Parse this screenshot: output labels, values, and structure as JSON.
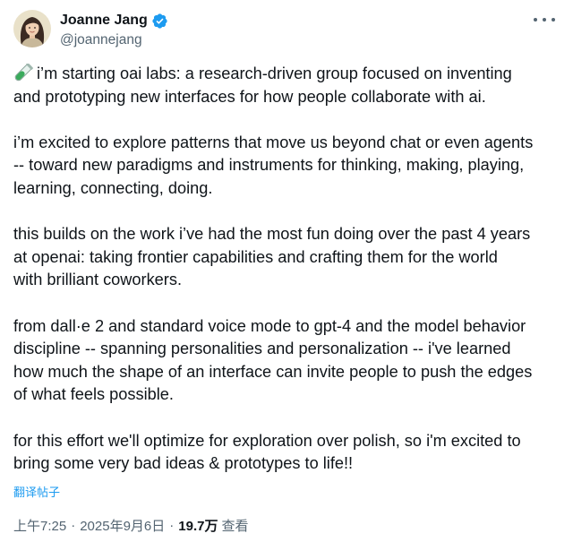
{
  "author": {
    "display_name": "Joanne Jang",
    "handle": "@joannejang",
    "verified": true,
    "avatar_icon": "avatar-illustration"
  },
  "tweet": {
    "lead_icon": "test-tube-icon",
    "paragraphs": [
      [
        "i’m starting oai labs: a research-driven group focused on inventing",
        "and prototyping new interfaces for how people collaborate with ai."
      ],
      [
        "i’m excited to explore patterns that move us beyond chat or even agents",
        "-- toward new paradigms and instruments for thinking, making, playing,",
        "learning, connecting, doing."
      ],
      [
        "this builds on the work i’ve had the most fun doing over the past 4 years",
        "at openai: taking frontier capabilities and crafting them for the world",
        "with brilliant coworkers."
      ],
      [
        "from dall·e 2 and standard voice mode to gpt-4 and the model behavior",
        "discipline -- spanning personalities and personalization -- i've learned",
        "how much the shape of an interface can invite people to push the edges",
        "of what feels possible."
      ],
      [
        "for this effort we'll optimize for exploration over polish, so i'm excited to",
        "bring some very bad ideas & prototypes to life!!"
      ]
    ],
    "translate_label": "翻译帖子"
  },
  "meta": {
    "time": "上午7:25",
    "separator": "·",
    "date": "2025年9月6日",
    "views_count": "19.7万",
    "views_label": "查看"
  },
  "colors": {
    "text": "#0f1419",
    "secondary": "#536471",
    "link": "#1d9bf0",
    "verified": "#1d9bf0"
  }
}
